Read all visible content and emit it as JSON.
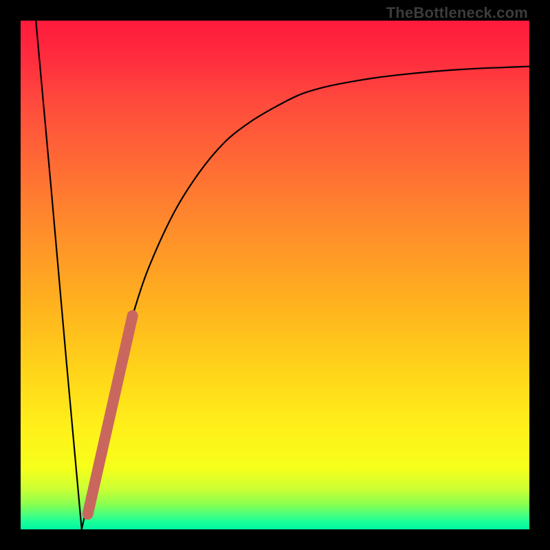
{
  "watermark": "TheBottleneck.com",
  "colors": {
    "frame": "#000000",
    "curve": "#000000",
    "highlight": "#c9675e",
    "gradient_top": "#ff1a3c",
    "gradient_bottom": "#00f5a0"
  },
  "chart_data": {
    "type": "line",
    "title": "",
    "xlabel": "",
    "ylabel": "",
    "xlim": [
      0,
      100
    ],
    "ylim": [
      0,
      100
    ],
    "grid": false,
    "legend": false,
    "notes": "V-shaped bottleneck-style curve on a vertical red→green gradient background. Left branch is a near-vertical line from the top-left down to a minimum near x≈12, y≈0. Right branch rises steeply then asymptotically flattens toward y≈90 at x=100. A thick salmon highlight segment sits on the right branch roughly between x≈14 and x≈22.",
    "series": [
      {
        "name": "curve",
        "x": [
          3,
          6,
          9,
          12,
          14,
          16,
          18,
          20,
          22,
          25,
          30,
          35,
          40,
          45,
          50,
          55,
          60,
          65,
          70,
          75,
          80,
          85,
          90,
          95,
          100
        ],
        "y": [
          100,
          67,
          33,
          0,
          9,
          18,
          27,
          35,
          42,
          51,
          62,
          70,
          76,
          80,
          83,
          85.5,
          87,
          88,
          88.8,
          89.4,
          89.9,
          90.3,
          90.6,
          90.8,
          91
        ]
      },
      {
        "name": "highlight_segment",
        "x": [
          13.2,
          22
        ],
        "y": [
          3,
          42
        ]
      }
    ]
  }
}
